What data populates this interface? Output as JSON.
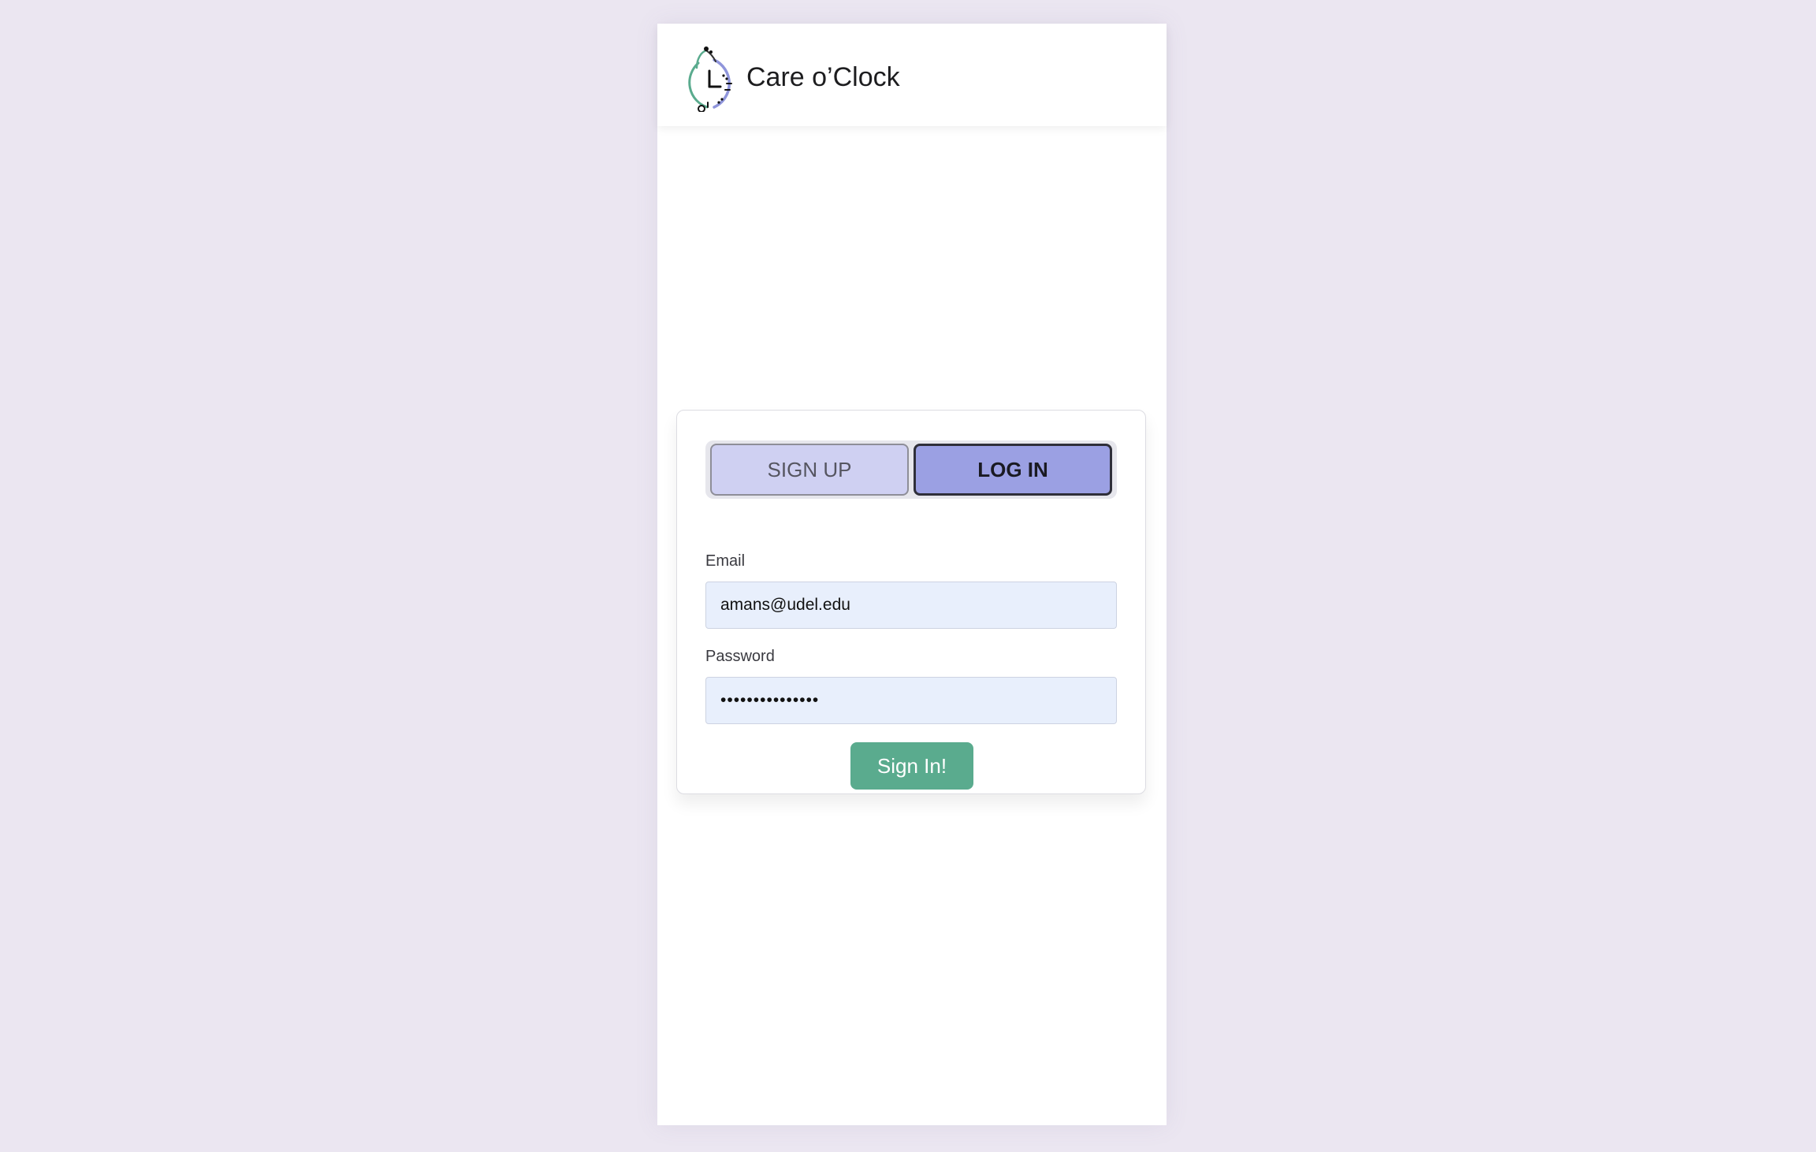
{
  "app": {
    "title": "Care o’Clock",
    "logo_icon": "clock-logo-icon"
  },
  "auth": {
    "tabs": [
      {
        "label": "SIGN UP",
        "active": false
      },
      {
        "label": "LOG IN",
        "active": true
      }
    ],
    "email": {
      "label": "Email",
      "value": "amans@udel.edu"
    },
    "password": {
      "label": "Password",
      "value": "•••••••••••••••"
    },
    "submit_label": "Sign In!"
  },
  "colors": {
    "page_background": "#ebe6f1",
    "tab_inactive": "#cfd0f2",
    "tab_active": "#9ba0e3",
    "input_background": "#e8effc",
    "submit_button": "#5aab8e",
    "logo_green": "#5aab8e",
    "logo_purple": "#8f95db"
  }
}
